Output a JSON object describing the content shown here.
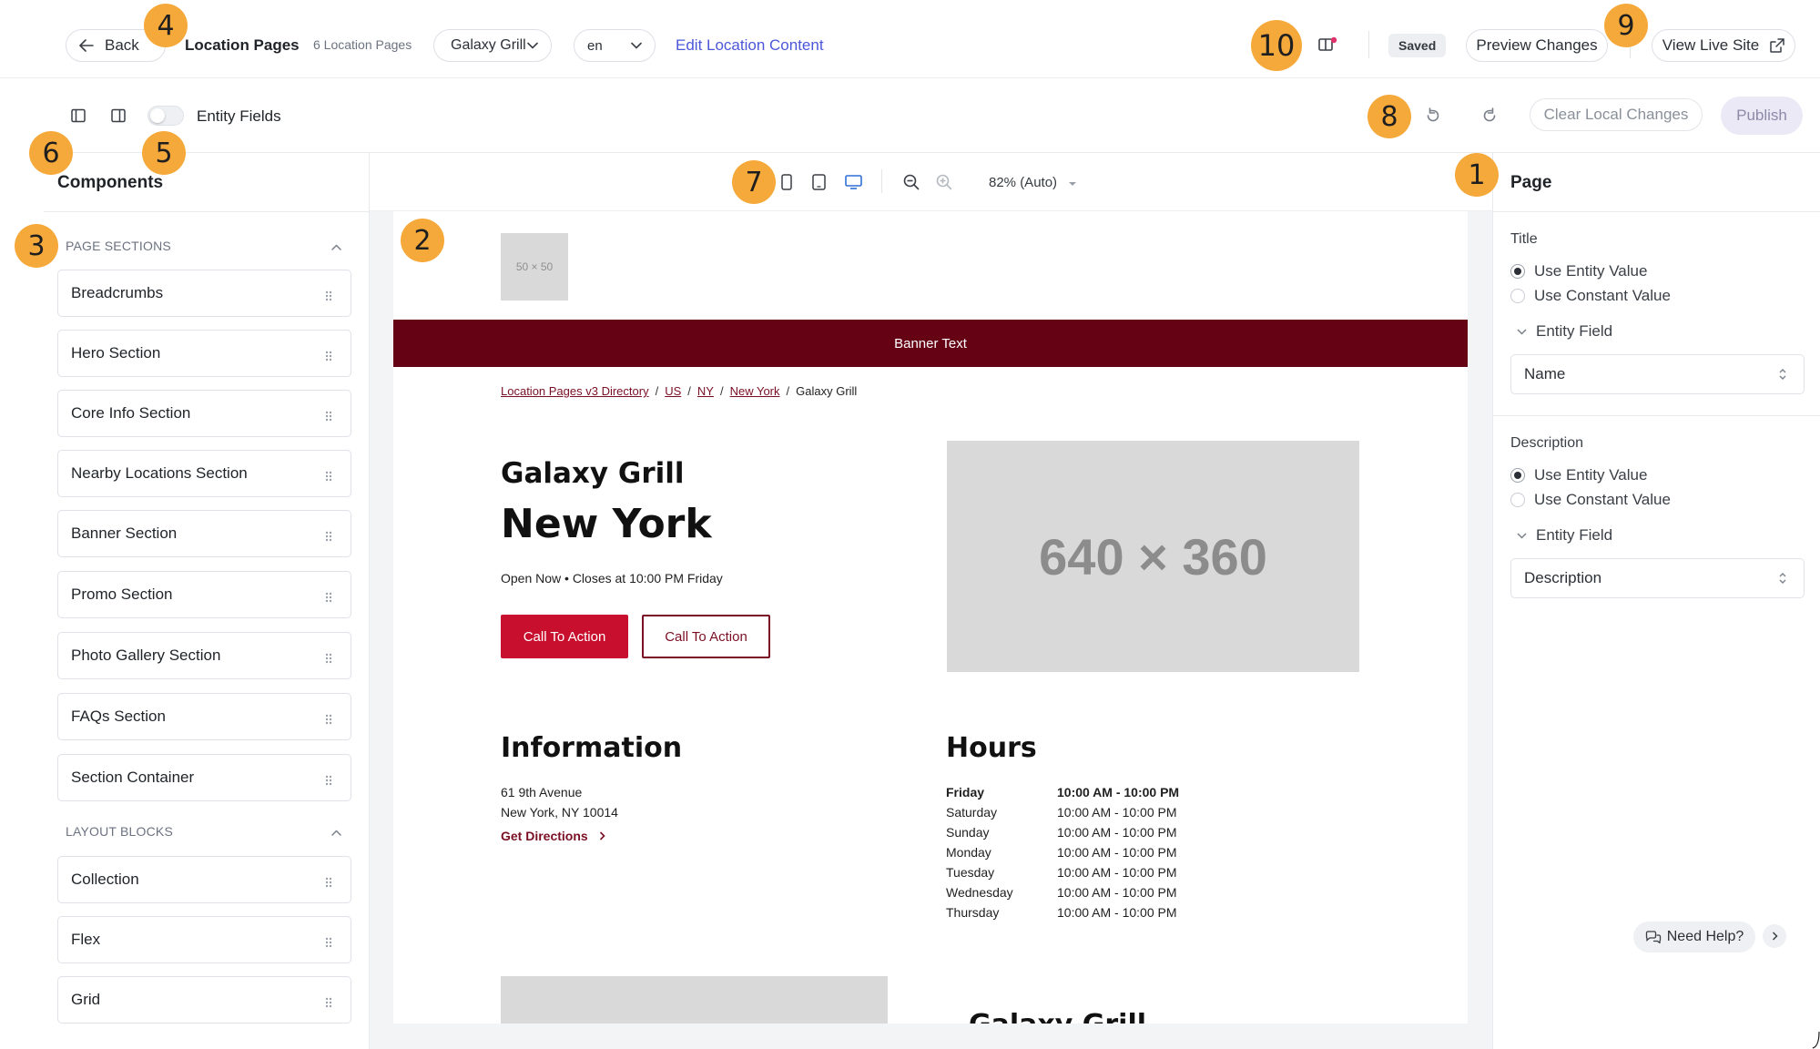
{
  "topbar": {
    "back_label": "Back",
    "title": "Location Pages",
    "count": "6 Location Pages",
    "location_select": "Galaxy Grill",
    "language_select": "en",
    "edit_link": "Edit Location Content",
    "saved_badge": "Saved",
    "preview_label": "Preview Changes",
    "live_label": "View Live Site"
  },
  "toolbar": {
    "entity_fields_label": "Entity Fields",
    "entity_fields_on": false,
    "clear_label": "Clear Local Changes",
    "publish_label": "Publish"
  },
  "left_panel": {
    "title": "Components",
    "page_sections_heading": "PAGE SECTIONS",
    "page_sections": [
      "Breadcrumbs",
      "Hero Section",
      "Core Info Section",
      "Nearby Locations Section",
      "Banner Section",
      "Promo Section",
      "Photo Gallery Section",
      "FAQs Section",
      "Section Container"
    ],
    "layout_blocks_heading": "LAYOUT BLOCKS",
    "layout_blocks": [
      "Collection",
      "Flex",
      "Grid"
    ]
  },
  "canvas": {
    "zoom_label": "82% (Auto)",
    "active_viewport": "desktop",
    "preview": {
      "logo_placeholder": "50 × 50",
      "banner_text": "Banner Text",
      "breadcrumbs": [
        "Location Pages v3 Directory",
        "US",
        "NY",
        "New York",
        "Galaxy Grill"
      ],
      "brand_name": "Galaxy Grill",
      "city": "New York",
      "open_status": "Open Now • Closes at 10:00 PM Friday",
      "cta_primary": "Call To Action",
      "cta_secondary": "Call To Action",
      "hero_image_placeholder": "640 × 360",
      "information_heading": "Information",
      "address_line1": "61 9th Avenue",
      "address_line2": "New York, NY 10014",
      "directions_label": "Get Directions",
      "hours_heading": "Hours",
      "hours": [
        {
          "day": "Friday",
          "time": "10:00 AM - 10:00 PM"
        },
        {
          "day": "Saturday",
          "time": "10:00 AM - 10:00 PM"
        },
        {
          "day": "Sunday",
          "time": "10:00 AM - 10:00 PM"
        },
        {
          "day": "Monday",
          "time": "10:00 AM - 10:00 PM"
        },
        {
          "day": "Tuesday",
          "time": "10:00 AM - 10:00 PM"
        },
        {
          "day": "Wednesday",
          "time": "10:00 AM - 10:00 PM"
        },
        {
          "day": "Thursday",
          "time": "10:00 AM - 10:00 PM"
        }
      ],
      "bottom_name": "Galaxy Grill"
    }
  },
  "right_panel": {
    "title": "Page",
    "title_field": {
      "label": "Title",
      "option_entity": "Use Entity Value",
      "option_constant": "Use Constant Value",
      "selected": "entity",
      "entity_field_label": "Entity Field",
      "entity_field_value": "Name"
    },
    "description_field": {
      "label": "Description",
      "option_entity": "Use Entity Value",
      "option_constant": "Use Constant Value",
      "selected": "entity",
      "entity_field_label": "Entity Field",
      "entity_field_value": "Description"
    },
    "help_label": "Need Help?"
  },
  "markers": [
    "1",
    "2",
    "3",
    "4",
    "5",
    "6",
    "7",
    "8",
    "9",
    "10"
  ],
  "colors": {
    "accent_link": "#4b57d8",
    "banner": "#650315",
    "cta_primary": "#c8102e",
    "marker": "#f6a93b"
  }
}
